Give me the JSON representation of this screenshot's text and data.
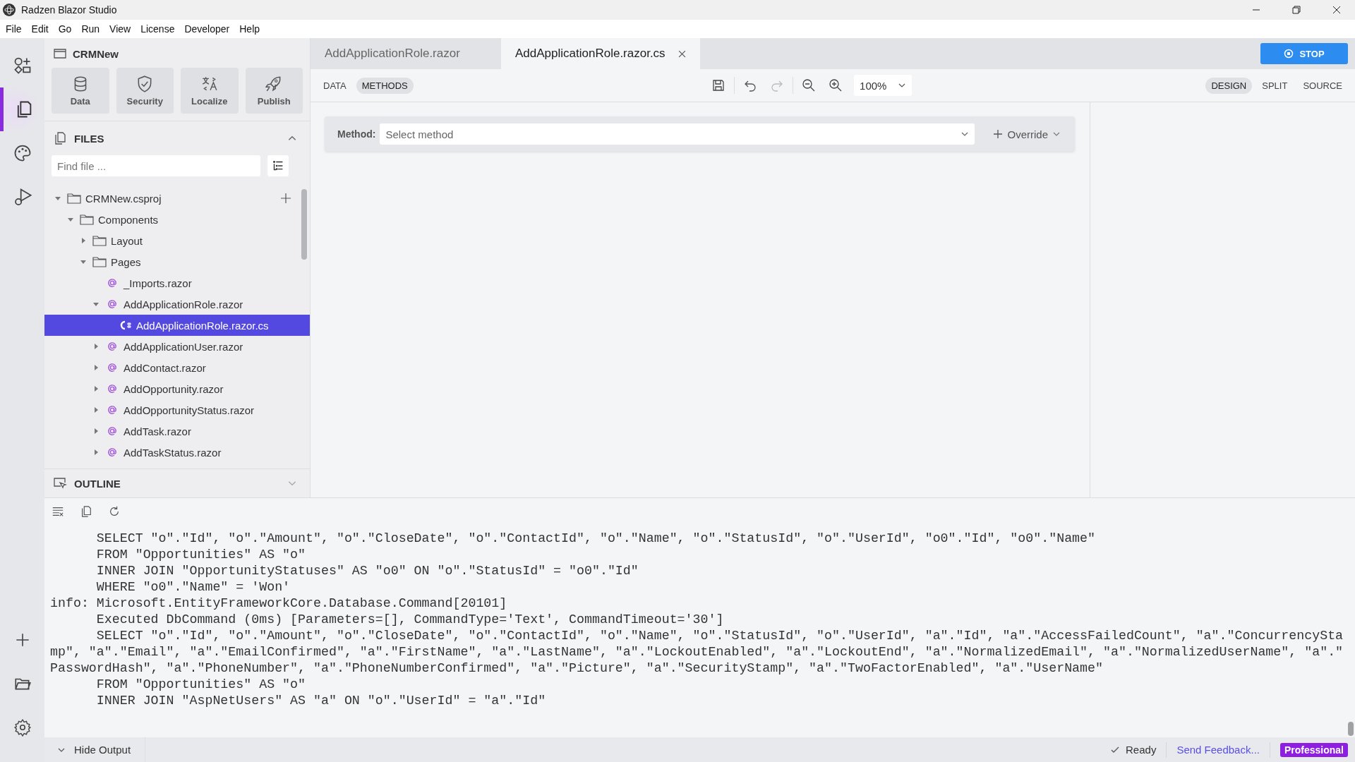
{
  "window": {
    "title": "Radzen Blazor Studio"
  },
  "menu": [
    "File",
    "Edit",
    "Go",
    "Run",
    "View",
    "License",
    "Developer",
    "Help"
  ],
  "activity_bar": [
    {
      "kind": "components",
      "selected": false
    },
    {
      "kind": "files",
      "selected": true
    },
    {
      "kind": "themes",
      "selected": false
    },
    {
      "kind": "debug",
      "selected": false
    }
  ],
  "project": {
    "name": "CRMNew",
    "actions": [
      {
        "kind": "data",
        "label": "Data"
      },
      {
        "kind": "security",
        "label": "Security"
      },
      {
        "kind": "localize",
        "label": "Localize"
      },
      {
        "kind": "publish",
        "label": "Publish"
      }
    ]
  },
  "files": {
    "title": "FILES",
    "expanded": true,
    "search": {
      "placeholder": "Find file ..."
    },
    "tree": [
      {
        "kind": "project",
        "name": "CRMNew.csproj",
        "expanded": true,
        "selected": false,
        "children": [
          {
            "kind": "folder",
            "name": "Components",
            "expanded": true,
            "selected": false,
            "children": [
              {
                "kind": "folder",
                "name": "Layout",
                "expanded": false,
                "selected": false
              },
              {
                "kind": "folder",
                "name": "Pages",
                "expanded": true,
                "selected": false,
                "children": [
                  {
                    "kind": "razor",
                    "name": "_Imports.razor",
                    "selected": false
                  },
                  {
                    "kind": "razor",
                    "name": "AddApplicationRole.razor",
                    "expanded": true,
                    "selected": false,
                    "children": [
                      {
                        "kind": "csharp",
                        "name": "AddApplicationRole.razor.cs",
                        "selected": true
                      }
                    ]
                  },
                  {
                    "kind": "razor",
                    "name": "AddApplicationUser.razor",
                    "expanded": false,
                    "selected": false
                  },
                  {
                    "kind": "razor",
                    "name": "AddContact.razor",
                    "expanded": false,
                    "selected": false
                  },
                  {
                    "kind": "razor",
                    "name": "AddOpportunity.razor",
                    "expanded": false,
                    "selected": false
                  },
                  {
                    "kind": "razor",
                    "name": "AddOpportunityStatus.razor",
                    "expanded": false,
                    "selected": false
                  },
                  {
                    "kind": "razor",
                    "name": "AddTask.razor",
                    "expanded": false,
                    "selected": false
                  },
                  {
                    "kind": "razor",
                    "name": "AddTaskStatus.razor",
                    "expanded": false,
                    "selected": false
                  }
                ]
              }
            ]
          }
        ]
      }
    ]
  },
  "outline": {
    "title": "OUTLINE",
    "expanded": false
  },
  "editor_tabs": [
    {
      "label": "AddApplicationRole.razor",
      "selected": false,
      "closable": false
    },
    {
      "label": "AddApplicationRole.razor.cs",
      "selected": true,
      "closable": true
    }
  ],
  "stop_button": "STOP",
  "mode_tabs": [
    {
      "label": "DATA",
      "selected": false
    },
    {
      "label": "METHODS",
      "selected": true
    }
  ],
  "zoom": "100%",
  "view_tabs": [
    {
      "label": "DESIGN",
      "selected": true
    },
    {
      "label": "SPLIT",
      "selected": false
    },
    {
      "label": "SOURCE",
      "selected": false
    }
  ],
  "method_bar": {
    "label": "Method:",
    "placeholder": "Select method",
    "override": "Override"
  },
  "output": {
    "lines": [
      "      SELECT \"o\".\"Id\", \"o\".\"Amount\", \"o\".\"CloseDate\", \"o\".\"ContactId\", \"o\".\"Name\", \"o\".\"StatusId\", \"o\".\"UserId\", \"o0\".\"Id\", \"o0\".\"Name\"",
      "      FROM \"Opportunities\" AS \"o\"",
      "      INNER JOIN \"OpportunityStatuses\" AS \"o0\" ON \"o\".\"StatusId\" = \"o0\".\"Id\"",
      "      WHERE \"o0\".\"Name\" = 'Won'",
      "info: Microsoft.EntityFrameworkCore.Database.Command[20101]",
      "      Executed DbCommand (0ms) [Parameters=[], CommandType='Text', CommandTimeout='30']",
      "      SELECT \"o\".\"Id\", \"o\".\"Amount\", \"o\".\"CloseDate\", \"o\".\"ContactId\", \"o\".\"Name\", \"o\".\"StatusId\", \"o\".\"UserId\", \"a\".\"Id\", \"a\".\"AccessFailedCount\", \"a\".\"ConcurrencyStamp\", \"a\".\"Email\", \"a\".\"EmailConfirmed\", \"a\".\"FirstName\", \"a\".\"LastName\", \"a\".\"LockoutEnabled\", \"a\".\"LockoutEnd\", \"a\".\"NormalizedEmail\", \"a\".\"NormalizedUserName\", \"a\".\"PasswordHash\", \"a\".\"PhoneNumber\", \"a\".\"PhoneNumberConfirmed\", \"a\".\"Picture\", \"a\".\"SecurityStamp\", \"a\".\"TwoFactorEnabled\", \"a\".\"UserName\"",
      "      FROM \"Opportunities\" AS \"o\"",
      "      INNER JOIN \"AspNetUsers\" AS \"a\" ON \"o\".\"UserId\" = \"a\".\"Id\""
    ]
  },
  "status_bar": {
    "hide_output": "Hide Output",
    "status": "Ready",
    "feedback": "Send Feedback...",
    "license": "Professional"
  }
}
